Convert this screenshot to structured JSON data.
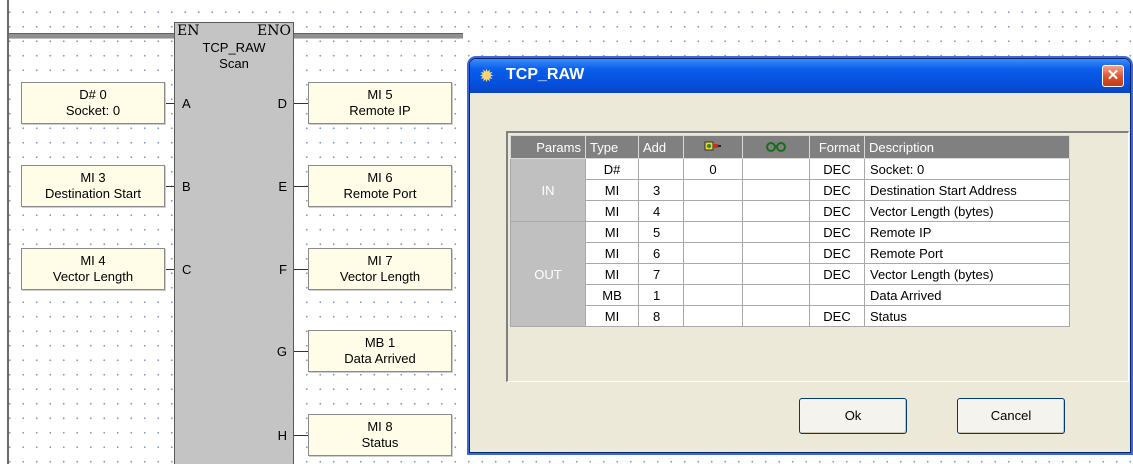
{
  "ladder": {
    "block": {
      "en": "EN",
      "eno": "ENO",
      "name": "TCP_RAW",
      "mode": "Scan",
      "pins_left": [
        "A",
        "B",
        "C"
      ],
      "pins_right": [
        "D",
        "E",
        "F",
        "G",
        "H"
      ]
    },
    "inputs": [
      {
        "op": "D# 0",
        "desc": "Socket: 0"
      },
      {
        "op": "MI 3",
        "desc": "Destination Start"
      },
      {
        "op": "MI 4",
        "desc": "Vector Length"
      }
    ],
    "outputs": [
      {
        "op": "MI 5",
        "desc": "Remote IP"
      },
      {
        "op": "MI 6",
        "desc": "Remote Port"
      },
      {
        "op": "MI 7",
        "desc": "Vector Length"
      },
      {
        "op": "MB 1",
        "desc": "Data Arrived"
      },
      {
        "op": "MI 8",
        "desc": "Status"
      }
    ]
  },
  "dialog": {
    "title": "TCP_RAW",
    "icon": "sun-icon",
    "close_label": "✕",
    "columns": [
      "Params",
      "Type",
      "Add",
      "plug-icon",
      "glasses-icon",
      "Format",
      "Description"
    ],
    "groups": {
      "in": "IN",
      "out": "OUT"
    },
    "rows": [
      {
        "type": "D#",
        "add": "",
        "cur": "0",
        "fmt": "DEC",
        "desc": "Socket: 0"
      },
      {
        "type": "MI",
        "add": "3",
        "cur": "",
        "fmt": "DEC",
        "desc": "Destination Start Address"
      },
      {
        "type": "MI",
        "add": "4",
        "cur": "",
        "fmt": "DEC",
        "desc": "Vector Length (bytes)"
      },
      {
        "type": "MI",
        "add": "5",
        "cur": "",
        "fmt": "DEC",
        "desc": "Remote IP"
      },
      {
        "type": "MI",
        "add": "6",
        "cur": "",
        "fmt": "DEC",
        "desc": "Remote Port"
      },
      {
        "type": "MI",
        "add": "7",
        "cur": "",
        "fmt": "DEC",
        "desc": "Vector Length (bytes)"
      },
      {
        "type": "MB",
        "add": "1",
        "cur": "",
        "fmt": "",
        "desc": "Data Arrived"
      },
      {
        "type": "MI",
        "add": "8",
        "cur": "",
        "fmt": "DEC",
        "desc": "Status"
      }
    ],
    "ok_label": "Ok",
    "cancel_label": "Cancel"
  },
  "colors": {
    "titlebar": "#0a5fea",
    "dialog_bg": "#ece9d8",
    "operand_bg": "#fffde8",
    "block_bg": "#c4c4c4",
    "header_bg": "#808080"
  }
}
